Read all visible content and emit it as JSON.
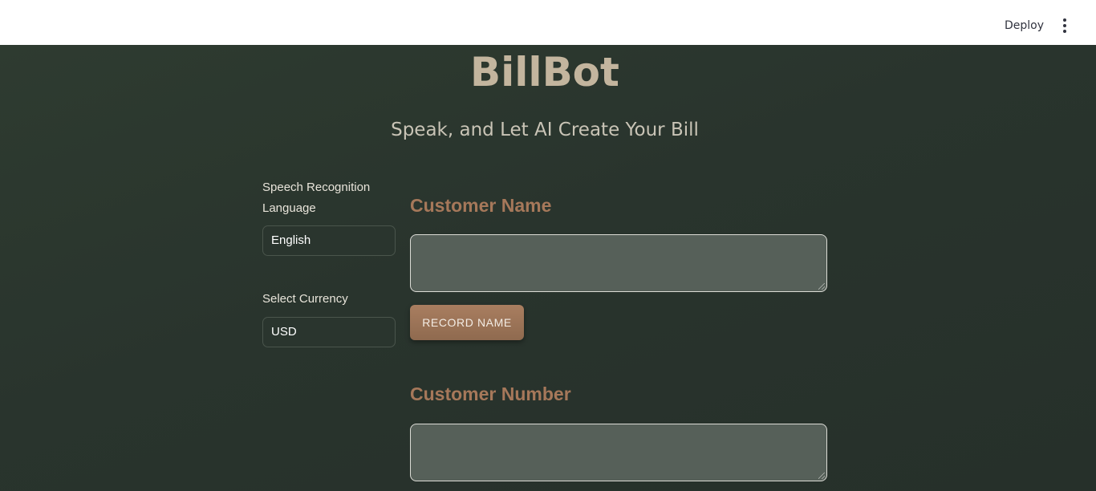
{
  "toolbar": {
    "deploy_label": "Deploy",
    "menu_icon": "vertical-ellipsis-icon"
  },
  "app": {
    "title": "BillBot",
    "subtitle": "Speak, and Let AI Create Your Bill"
  },
  "settings": {
    "language_label": "Speech Recognition Language",
    "language_value": "English",
    "currency_label": "Select Currency",
    "currency_value": "USD"
  },
  "customer_name": {
    "heading": "Customer Name",
    "value": "",
    "record_button": "RECORD NAME"
  },
  "customer_number": {
    "heading": "Customer Number",
    "value": ""
  },
  "colors": {
    "background": "#2a352e",
    "title": "#c3b59e",
    "heading_accent": "#a6785a",
    "button": "#9c7558",
    "field": "#566059"
  }
}
